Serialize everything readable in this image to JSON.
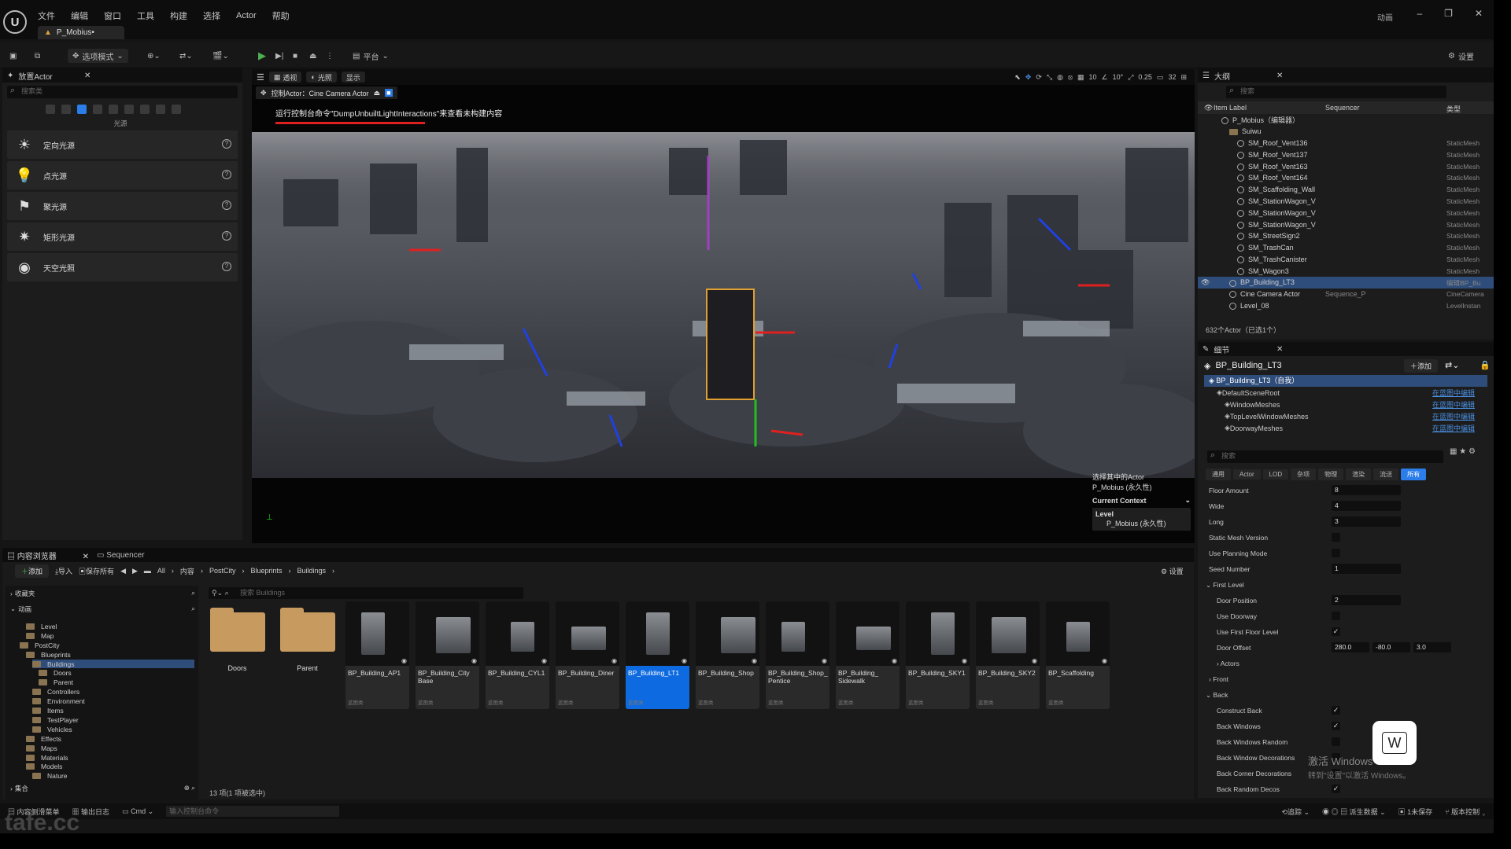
{
  "menu": [
    "文件",
    "编辑",
    "窗口",
    "工具",
    "构建",
    "选择",
    "Actor",
    "帮助"
  ],
  "doc_tab": "P_Mobius•",
  "window_label": "动画",
  "toolbar": {
    "mode": "选项模式",
    "platform": "平台",
    "settings": "设置"
  },
  "place_actor": {
    "title": "放置Actor",
    "search_placeholder": "搜索类",
    "category": "光源",
    "items": [
      {
        "label": "定向光源",
        "icon": "directional-light-icon"
      },
      {
        "label": "点光源",
        "icon": "point-light-icon"
      },
      {
        "label": "聚光源",
        "icon": "spot-light-icon"
      },
      {
        "label": "矩形光源",
        "icon": "rect-light-icon"
      },
      {
        "label": "天空光照",
        "icon": "sky-light-icon"
      }
    ]
  },
  "viewport": {
    "buttons": [
      "透视",
      "光照",
      "显示"
    ],
    "pilot_label": "控制Actor：Cine Camera Actor",
    "message": "运行控制台命令\"DumpUnbuiltLightInteractions\"来查看未构建内容",
    "right_values": [
      "10",
      "10°",
      "0.25",
      "32"
    ],
    "selection_info": "选择其中的Actor",
    "selection_name": "P_Mobius (永久性)",
    "current_context": "Current Context",
    "context_level": "Level",
    "context_value": "P_Mobius (永久性)"
  },
  "outliner": {
    "title": "大纲",
    "search_placeholder": "搜索",
    "col_label": "Item Label",
    "col_seq": "Sequencer",
    "col_type": "类型",
    "rows": [
      {
        "name": "P_Mobius（编辑器）",
        "type": "",
        "indent": 1,
        "kind": "map"
      },
      {
        "name": "Suiwu",
        "type": "",
        "indent": 2,
        "kind": "folder"
      },
      {
        "name": "SM_Roof_Vent136",
        "type": "StaticMesh",
        "indent": 3,
        "kind": "mesh"
      },
      {
        "name": "SM_Roof_Vent137",
        "type": "StaticMesh",
        "indent": 3,
        "kind": "mesh"
      },
      {
        "name": "SM_Roof_Vent163",
        "type": "StaticMesh",
        "indent": 3,
        "kind": "mesh"
      },
      {
        "name": "SM_Roof_Vent164",
        "type": "StaticMesh",
        "indent": 3,
        "kind": "mesh"
      },
      {
        "name": "SM_Scaffolding_Wall",
        "type": "StaticMesh",
        "indent": 3,
        "kind": "mesh"
      },
      {
        "name": "SM_StationWagon_V",
        "type": "StaticMesh",
        "indent": 3,
        "kind": "mesh"
      },
      {
        "name": "SM_StationWagon_V",
        "type": "StaticMesh",
        "indent": 3,
        "kind": "mesh"
      },
      {
        "name": "SM_StationWagon_V",
        "type": "StaticMesh",
        "indent": 3,
        "kind": "mesh"
      },
      {
        "name": "SM_StreetSign2",
        "type": "StaticMesh",
        "indent": 3,
        "kind": "mesh"
      },
      {
        "name": "SM_TrashCan",
        "type": "StaticMesh",
        "indent": 3,
        "kind": "mesh"
      },
      {
        "name": "SM_TrashCanister",
        "type": "StaticMesh",
        "indent": 3,
        "kind": "mesh"
      },
      {
        "name": "SM_Wagon3",
        "type": "StaticMesh",
        "indent": 3,
        "kind": "mesh"
      },
      {
        "name": "BP_Building_LT3",
        "type": "编辑BP_Bu",
        "indent": 2,
        "kind": "bp",
        "selected": true
      },
      {
        "name": "Cine Camera Actor",
        "type": "CineCamera",
        "seq": "Sequence_P",
        "indent": 2,
        "kind": "cam"
      },
      {
        "name": "Level_08",
        "type": "LevelInstan",
        "indent": 2,
        "kind": "level"
      }
    ],
    "count": "632个Actor（已选1个）"
  },
  "details": {
    "title": "细节",
    "actor_name": "BP_Building_LT3",
    "add_label": "添加",
    "self_label": "BP_Building_LT3（自我）",
    "components": [
      {
        "name": "DefaultSceneRoot",
        "link": "在蓝图中编辑"
      },
      {
        "name": "WindowMeshes",
        "link": "在蓝图中编辑"
      },
      {
        "name": "TopLevelWindowMeshes",
        "link": "在蓝图中编辑"
      },
      {
        "name": "DoorwayMeshes",
        "link": "在蓝图中编辑"
      }
    ],
    "search_placeholder": "搜索",
    "tabs": [
      "通用",
      "Actor",
      "LOD",
      "杂项",
      "物理",
      "渲染",
      "流送",
      "所有"
    ],
    "props": [
      {
        "label": "Floor Amount",
        "value": "8",
        "kind": "text",
        "indent": 0
      },
      {
        "label": "Wide",
        "value": "4",
        "kind": "text",
        "indent": 0
      },
      {
        "label": "Long",
        "value": "3",
        "kind": "text",
        "indent": 0
      },
      {
        "label": "Static Mesh Version",
        "value": "",
        "kind": "check",
        "indent": 0
      },
      {
        "label": "Use Planning Mode",
        "value": "",
        "kind": "check",
        "indent": 0
      },
      {
        "label": "Seed Number",
        "value": "1",
        "kind": "text",
        "indent": 0
      },
      {
        "label": "First Level",
        "value": "",
        "kind": "section",
        "indent": 0
      },
      {
        "label": "Door Position",
        "value": "2",
        "kind": "text",
        "indent": 1
      },
      {
        "label": "Use Doorway",
        "value": "",
        "kind": "check",
        "indent": 1
      },
      {
        "label": "Use First Floor Level",
        "value": "✓",
        "kind": "check",
        "indent": 1
      },
      {
        "label": "Door Offset",
        "value": "280.0|-80.0|3.0",
        "kind": "vec",
        "indent": 1
      },
      {
        "label": "Actors",
        "value": "",
        "kind": "sub",
        "indent": 1
      },
      {
        "label": "Front",
        "value": "",
        "kind": "sub",
        "indent": 0
      },
      {
        "label": "Back",
        "value": "",
        "kind": "section",
        "indent": 0
      },
      {
        "label": "Construct Back",
        "value": "✓",
        "kind": "check",
        "indent": 1
      },
      {
        "label": "Back Windows",
        "value": "✓",
        "kind": "check",
        "indent": 1
      },
      {
        "label": "Back Windows Random",
        "value": "",
        "kind": "check",
        "indent": 1
      },
      {
        "label": "Back Window Decorations",
        "value": "",
        "kind": "check",
        "indent": 1
      },
      {
        "label": "Back Corner Decorations",
        "value": "",
        "kind": "check",
        "indent": 1
      },
      {
        "label": "Back Random Decos",
        "value": "✓",
        "kind": "check",
        "indent": 1
      }
    ]
  },
  "content_browser": {
    "tab": "内容浏览器",
    "tab2": "Sequencer",
    "add": "添加",
    "import": "导入",
    "save_all": "保存所有",
    "path": [
      "All",
      "内容",
      "PostCity",
      "Blueprints",
      "Buildings"
    ],
    "settings": "设置",
    "favorites": "收藏夹",
    "project": "动画",
    "collections": "集合",
    "search_placeholder": "搜索 Buildings",
    "tree": [
      {
        "label": "Level",
        "indent": 2
      },
      {
        "label": "Map",
        "indent": 2
      },
      {
        "label": "PostCity",
        "indent": 1
      },
      {
        "label": "Blueprints",
        "indent": 2
      },
      {
        "label": "Buildings",
        "indent": 3,
        "selected": true
      },
      {
        "label": "Doors",
        "indent": 4
      },
      {
        "label": "Parent",
        "indent": 4
      },
      {
        "label": "Controllers",
        "indent": 3
      },
      {
        "label": "Environment",
        "indent": 3
      },
      {
        "label": "Items",
        "indent": 3
      },
      {
        "label": "TestPlayer",
        "indent": 3
      },
      {
        "label": "Vehicles",
        "indent": 3
      },
      {
        "label": "Effects",
        "indent": 2
      },
      {
        "label": "Maps",
        "indent": 2
      },
      {
        "label": "Materials",
        "indent": 2
      },
      {
        "label": "Models",
        "indent": 2
      },
      {
        "label": "Nature",
        "indent": 3
      }
    ],
    "folders": [
      "Doors",
      "Parent"
    ],
    "assets": [
      {
        "name": "BP_Building_AP1",
        "cls": "蓝图类"
      },
      {
        "name": "BP_Building_City Base",
        "cls": "蓝图类"
      },
      {
        "name": "BP_Building_CYL1",
        "cls": "蓝图类"
      },
      {
        "name": "BP_Building_Diner",
        "cls": "蓝图类"
      },
      {
        "name": "BP_Building_LT1",
        "cls": "蓝图类",
        "selected": true
      },
      {
        "name": "BP_Building_Shop",
        "cls": "蓝图类"
      },
      {
        "name": "BP_Building_Shop_ Pentice",
        "cls": "蓝图类"
      },
      {
        "name": "BP_Building_ Sidewalk",
        "cls": "蓝图类"
      },
      {
        "name": "BP_Building_SKY1",
        "cls": "蓝图类"
      },
      {
        "name": "BP_Building_SKY2",
        "cls": "蓝图类"
      },
      {
        "name": "BP_Scaffolding",
        "cls": "蓝图类"
      }
    ],
    "count": "13 项(1 项被选中)"
  },
  "statusbar": {
    "drawer": "内容侧滑菜单",
    "log": "输出日志",
    "cmd": "Cmd",
    "cmd_placeholder": "输入控制台命令",
    "trace": "追踪",
    "derived": "派生数据",
    "unsaved": "1未保存",
    "source": "版本控制"
  },
  "overlay": {
    "activate": "激活 Windows",
    "activate_sub": "转到\"设置\"以激活 Windows。",
    "key": "W",
    "watermark": "tafe.cc"
  }
}
